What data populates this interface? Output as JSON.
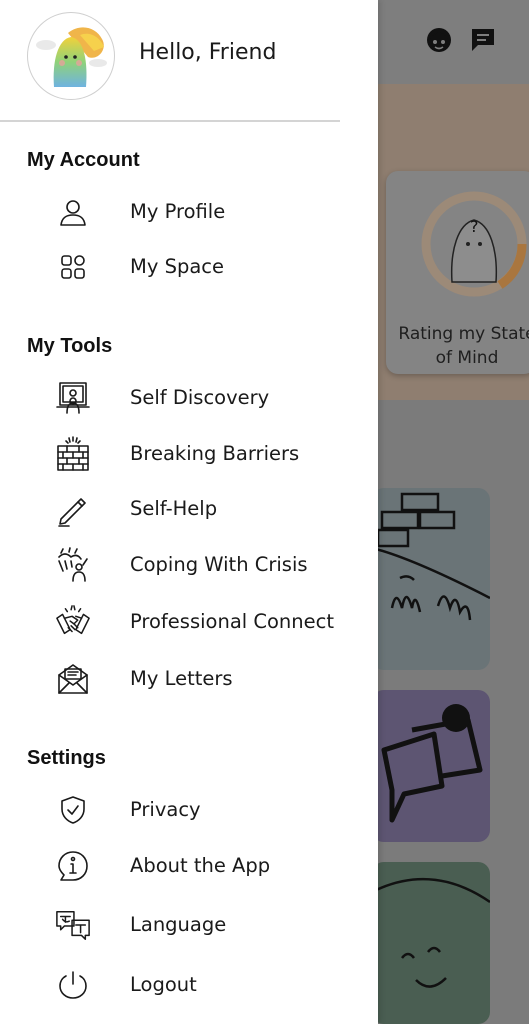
{
  "header": {
    "greeting": "Hello, Friend"
  },
  "background": {
    "card_title": "Rating my State of Mind"
  },
  "sections": [
    {
      "title": "My Account"
    },
    {
      "title": "My Tools"
    },
    {
      "title": "Settings"
    }
  ],
  "menu": {
    "my_profile": {
      "label": "My Profile",
      "icon": "person-icon"
    },
    "my_space": {
      "label": "My Space",
      "icon": "grid-icon"
    },
    "self_discovery": {
      "label": "Self Discovery",
      "icon": "mirror-person-icon"
    },
    "breaking_barriers": {
      "label": "Breaking Barriers",
      "icon": "brick-wall-icon"
    },
    "self_help": {
      "label": "Self-Help",
      "icon": "pencil-icon"
    },
    "coping_with_crisis": {
      "label": "Coping With Crisis",
      "icon": "storm-person-icon"
    },
    "professional_connect": {
      "label": "Professional Connect",
      "icon": "handshake-icon"
    },
    "my_letters": {
      "label": "My Letters",
      "icon": "envelope-icon"
    },
    "privacy": {
      "label": "Privacy",
      "icon": "shield-check-icon"
    },
    "about_the_app": {
      "label": "About the App",
      "icon": "info-bubble-icon"
    },
    "language": {
      "label": "Language",
      "icon": "translate-icon"
    },
    "logout": {
      "label": "Logout",
      "icon": "power-icon"
    }
  },
  "colors": {
    "drawer": "#ffffff",
    "divider": "#d4d4d4",
    "text": "#1a1a1a",
    "accent_ring": "#e8a25a"
  }
}
